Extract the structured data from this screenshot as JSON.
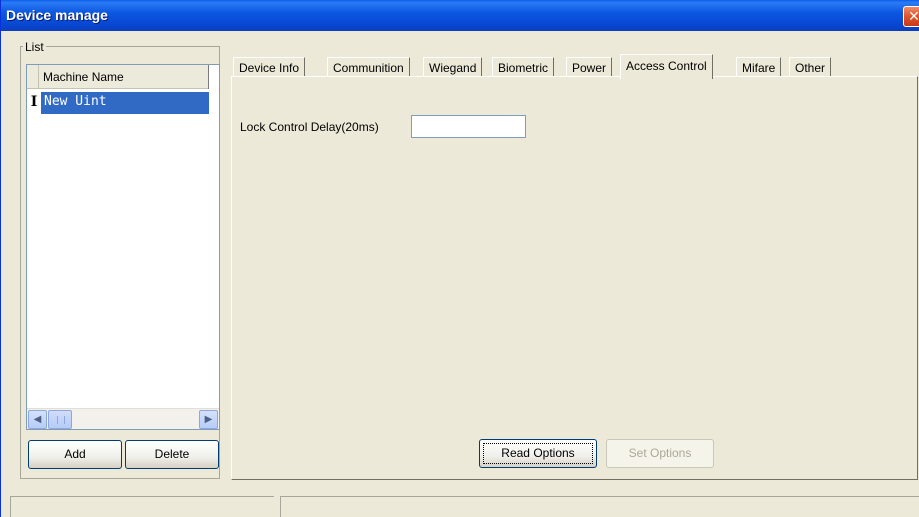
{
  "window": {
    "title": "Device manage",
    "close_label": "✕"
  },
  "list": {
    "group_label": "List",
    "column_header": "Machine Name",
    "rows": [
      {
        "marker": "I",
        "name": "New Uint"
      }
    ],
    "scroll_left": "◀",
    "scroll_right": "▶"
  },
  "buttons": {
    "add": "Add",
    "delete": "Delete",
    "read_options": "Read Options",
    "set_options": "Set Options"
  },
  "tabs": [
    "Device Info",
    "Communition",
    "Wiegand",
    "Biometric",
    "Power",
    "Access Control",
    "Mifare",
    "Other"
  ],
  "active_tab": "Access Control",
  "access_control": {
    "lock_delay_label": "Lock Control Delay(20ms)",
    "lock_delay_value": ""
  },
  "colors": {
    "titlebar": "#0a58e0",
    "selection": "#316ac5",
    "window_bg": "#ece9d8"
  }
}
